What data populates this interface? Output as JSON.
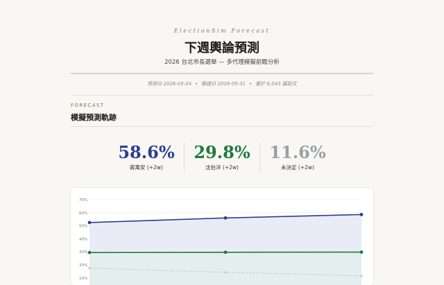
{
  "header": {
    "brand": "ElectionSim Forecast",
    "title": "下週輿論預測",
    "subtitle": "2026 台北市長選舉 — 多代理模擬前瞻分析",
    "meta": [
      "預測日 2026-05-24",
      "驗證日 2026-05-31",
      "基於 6,043 篇貼文"
    ]
  },
  "section": {
    "kicker": "FORECAST",
    "title": "模擬預測軌跡"
  },
  "stats": [
    {
      "value": "58.6%",
      "label": "蔣萬安 (+2w)",
      "color": "#2a3f8f"
    },
    {
      "value": "29.8%",
      "label": "沈伯洋 (+2w)",
      "color": "#1f7a3e"
    },
    {
      "value": "11.6%",
      "label": "未決定 (+2w)",
      "color": "#9aa0a6"
    }
  ],
  "chart_data": {
    "type": "line",
    "yticks": [
      "70%",
      "60%",
      "50%",
      "40%",
      "30%",
      "20%",
      "10%"
    ],
    "ylim": [
      0,
      70
    ],
    "x": [
      0,
      1,
      2
    ],
    "series": [
      {
        "values": [
          52.5,
          56.0,
          58.6
        ],
        "color": "#2a3f8f",
        "fill": "#e9ecf7",
        "style": "solid"
      },
      {
        "values": [
          29.5,
          29.7,
          29.8
        ],
        "color": "#1f7a3e",
        "fill": "#e3efee",
        "style": "solid"
      },
      {
        "values": [
          17.5,
          14.3,
          11.6
        ],
        "color": "#c3c7cc",
        "fill": "none",
        "style": "dashed"
      }
    ],
    "grid": true
  }
}
